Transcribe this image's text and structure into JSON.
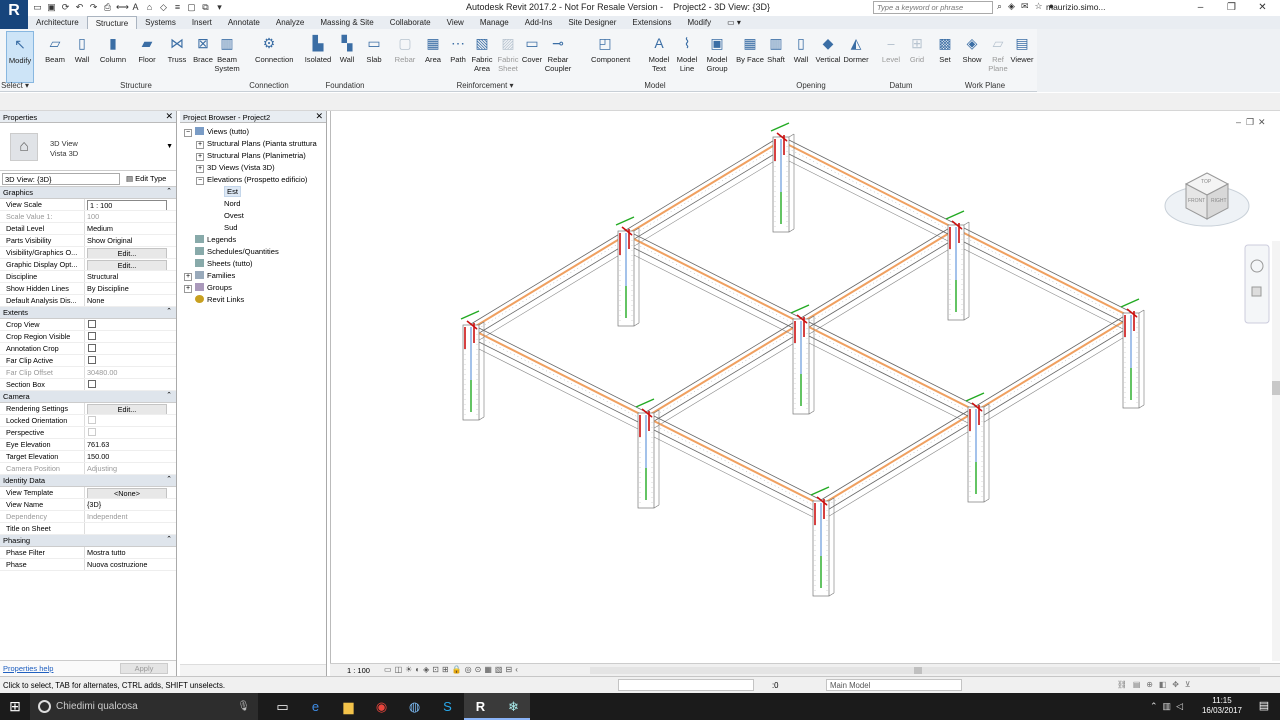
{
  "title_bar": {
    "app_logo": "R",
    "app_title": "Autodesk Revit 2017.2 -  Not For Resale Version -",
    "doc_title": "Project2 - 3D View: {3D}",
    "search_placeholder": "Type a keyword or phrase",
    "user": "maurizio.simo..."
  },
  "ribbon_tabs": [
    "Architecture",
    "Structure",
    "Systems",
    "Insert",
    "Annotate",
    "Analyze",
    "Massing & Site",
    "Collaborate",
    "View",
    "Manage",
    "Add-Ins",
    "Site Designer",
    "Extensions",
    "Modify",
    "▭ ▾"
  ],
  "ribbon_buttons": [
    {
      "label": "Modify",
      "icon": "cursor-icon"
    },
    {
      "label": "Beam",
      "icon": "beam-icon"
    },
    {
      "label": "Wall",
      "icon": "wall-icon"
    },
    {
      "label": "Column",
      "icon": "column-icon"
    },
    {
      "label": "Floor",
      "icon": "floor-icon"
    },
    {
      "label": "Truss",
      "icon": "truss-icon"
    },
    {
      "label": "Brace",
      "icon": "brace-icon"
    },
    {
      "label": "Beam System",
      "icon": "beam-system-icon"
    },
    {
      "label": "Connection",
      "icon": "connection-icon"
    },
    {
      "label": "Isolated",
      "icon": "isolated-icon"
    },
    {
      "label": "Wall",
      "icon": "wall-foundation-icon"
    },
    {
      "label": "Slab",
      "icon": "slab-icon"
    },
    {
      "label": "Rebar",
      "icon": "rebar-icon"
    },
    {
      "label": "Area",
      "icon": "area-icon"
    },
    {
      "label": "Path",
      "icon": "path-icon"
    },
    {
      "label": "Fabric Area",
      "icon": "fabric-area-icon"
    },
    {
      "label": "Fabric Sheet",
      "icon": "fabric-sheet-icon"
    },
    {
      "label": "Cover",
      "icon": "cover-icon"
    },
    {
      "label": "Rebar Coupler",
      "icon": "rebar-coupler-icon"
    },
    {
      "label": "Component",
      "icon": "component-icon"
    },
    {
      "label": "Model Text",
      "icon": "model-text-icon"
    },
    {
      "label": "Model Line",
      "icon": "model-line-icon"
    },
    {
      "label": "Model Group",
      "icon": "model-group-icon"
    },
    {
      "label": "By Face",
      "icon": "by-face-icon"
    },
    {
      "label": "Shaft",
      "icon": "shaft-icon"
    },
    {
      "label": "Wall",
      "icon": "wall-opening-icon"
    },
    {
      "label": "Vertical",
      "icon": "vertical-icon"
    },
    {
      "label": "Dormer",
      "icon": "dormer-icon"
    },
    {
      "label": "Level",
      "icon": "level-icon"
    },
    {
      "label": "Grid",
      "icon": "grid-icon"
    },
    {
      "label": "Set",
      "icon": "set-icon"
    },
    {
      "label": "Show",
      "icon": "show-icon"
    },
    {
      "label": "Ref Plane",
      "icon": "ref-plane-icon"
    },
    {
      "label": "Viewer",
      "icon": "viewer-icon"
    }
  ],
  "ribbon_panels": [
    "Select ▾",
    "Structure",
    "Connection",
    "Foundation",
    "Reinforcement ▾",
    "Model",
    "Opening",
    "Datum",
    "Work Plane"
  ],
  "properties": {
    "title": "Properties",
    "type_line1": "3D View",
    "type_line2": "Vista 3D",
    "view_selector": "3D View: {3D}",
    "edit_type": "Edit Type",
    "sections": [
      {
        "name": "Graphics",
        "rows": [
          {
            "k": "View Scale",
            "v": "1 : 100",
            "kind": "input"
          },
          {
            "k": "Scale Value    1:",
            "v": "100",
            "kind": "dim"
          },
          {
            "k": "Detail Level",
            "v": "Medium"
          },
          {
            "k": "Parts Visibility",
            "v": "Show Original"
          },
          {
            "k": "Visibility/Graphics O...",
            "v": "Edit...",
            "kind": "button"
          },
          {
            "k": "Graphic Display Opt...",
            "v": "Edit...",
            "kind": "button"
          },
          {
            "k": "Discipline",
            "v": "Structural"
          },
          {
            "k": "Show Hidden Lines",
            "v": "By Discipline"
          },
          {
            "k": "Default Analysis Dis...",
            "v": "None"
          }
        ]
      },
      {
        "name": "Extents",
        "rows": [
          {
            "k": "Crop View",
            "v": "",
            "kind": "check"
          },
          {
            "k": "Crop Region Visible",
            "v": "",
            "kind": "check"
          },
          {
            "k": "Annotation Crop",
            "v": "",
            "kind": "check"
          },
          {
            "k": "Far Clip Active",
            "v": "",
            "kind": "check"
          },
          {
            "k": "Far Clip Offset",
            "v": "30480.00",
            "kind": "dim"
          },
          {
            "k": "Section Box",
            "v": "",
            "kind": "check"
          }
        ]
      },
      {
        "name": "Camera",
        "rows": [
          {
            "k": "Rendering Settings",
            "v": "Edit...",
            "kind": "button"
          },
          {
            "k": "Locked Orientation",
            "v": "",
            "kind": "dimcheck"
          },
          {
            "k": "Perspective",
            "v": "",
            "kind": "dimcheck"
          },
          {
            "k": "Eye Elevation",
            "v": "761.63"
          },
          {
            "k": "Target Elevation",
            "v": "150.00"
          },
          {
            "k": "Camera Position",
            "v": "Adjusting",
            "kind": "dim"
          }
        ]
      },
      {
        "name": "Identity Data",
        "rows": [
          {
            "k": "View Template",
            "v": "<None>",
            "kind": "button"
          },
          {
            "k": "View Name",
            "v": "{3D}"
          },
          {
            "k": "Dependency",
            "v": "Independent",
            "kind": "dim"
          },
          {
            "k": "Title on Sheet",
            "v": ""
          }
        ]
      },
      {
        "name": "Phasing",
        "rows": [
          {
            "k": "Phase Filter",
            "v": "Mostra tutto"
          },
          {
            "k": "Phase",
            "v": "Nuova costruzione"
          }
        ]
      }
    ],
    "help_link": "Properties help",
    "apply": "Apply"
  },
  "browser": {
    "title": "Project Browser - Project2",
    "nodes": [
      {
        "label": "Views (tutto)",
        "depth": 0,
        "toggle": "−",
        "icon": "views"
      },
      {
        "label": "Structural Plans (Pianta struttura",
        "depth": 1,
        "toggle": "+"
      },
      {
        "label": "Structural Plans (Planimetria)",
        "depth": 1,
        "toggle": "+"
      },
      {
        "label": "3D Views (Vista 3D)",
        "depth": 1,
        "toggle": "+"
      },
      {
        "label": "Elevations (Prospetto edificio)",
        "depth": 1,
        "toggle": "−"
      },
      {
        "label": "Est",
        "depth": 2,
        "selected": true
      },
      {
        "label": "Nord",
        "depth": 2
      },
      {
        "label": "Ovest",
        "depth": 2
      },
      {
        "label": "Sud",
        "depth": 2
      },
      {
        "label": "Legends",
        "depth": 0,
        "icon": "doc"
      },
      {
        "label": "Schedules/Quantities",
        "depth": 0,
        "icon": "doc"
      },
      {
        "label": "Sheets (tutto)",
        "depth": 0,
        "icon": "doc"
      },
      {
        "label": "Families",
        "depth": 0,
        "toggle": "+",
        "icon": "fam"
      },
      {
        "label": "Groups",
        "depth": 0,
        "toggle": "+",
        "icon": "grp"
      },
      {
        "label": "Revit Links",
        "depth": 0,
        "icon": "link"
      }
    ]
  },
  "view_bar": {
    "scale": "1 : 100"
  },
  "status": {
    "message": "Click to select, TAB for alternates, CTRL adds, SHIFT unselects.",
    "zero": ":0",
    "model": "Main Model"
  },
  "taskbar": {
    "search": "Chiedimi qualcosa",
    "time": "11:15",
    "date": "16/03/2017"
  },
  "viewcube": {
    "top": "TOP",
    "front": "FRONT",
    "right": "RIGHT"
  },
  "colors": {
    "beam_orange": "#f0a060",
    "rebar_red": "#cc1111",
    "rebar_green": "#22aa22",
    "rebar_blue": "#6699dd",
    "accent": "#17457c"
  }
}
